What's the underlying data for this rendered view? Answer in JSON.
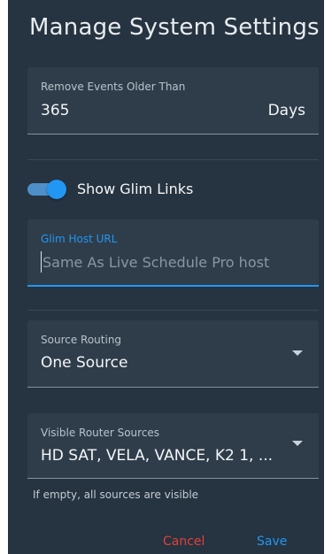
{
  "dialog": {
    "title": "Manage System Settings"
  },
  "remove_events": {
    "label": "Remove Events Older Than",
    "value": "365",
    "suffix": "Days"
  },
  "glim_links": {
    "label": "Show Glim Links",
    "enabled": true
  },
  "glim_host": {
    "label": "Glim Host URL",
    "placeholder": "Same As Live Schedule Pro host",
    "value": ""
  },
  "source_routing": {
    "label": "Source Routing",
    "value": "One Source"
  },
  "visible_sources": {
    "label": "Visible Router Sources",
    "value": "HD SAT, VELA, VANCE, K2 1, ...",
    "helper": "If empty, all sources are visible"
  },
  "actions": {
    "cancel_label": "Cancel",
    "save_label": "Save"
  },
  "colors": {
    "background": "#263340",
    "field": "#2f3d4a",
    "accent": "#2196f3",
    "danger": "#e0413a"
  }
}
